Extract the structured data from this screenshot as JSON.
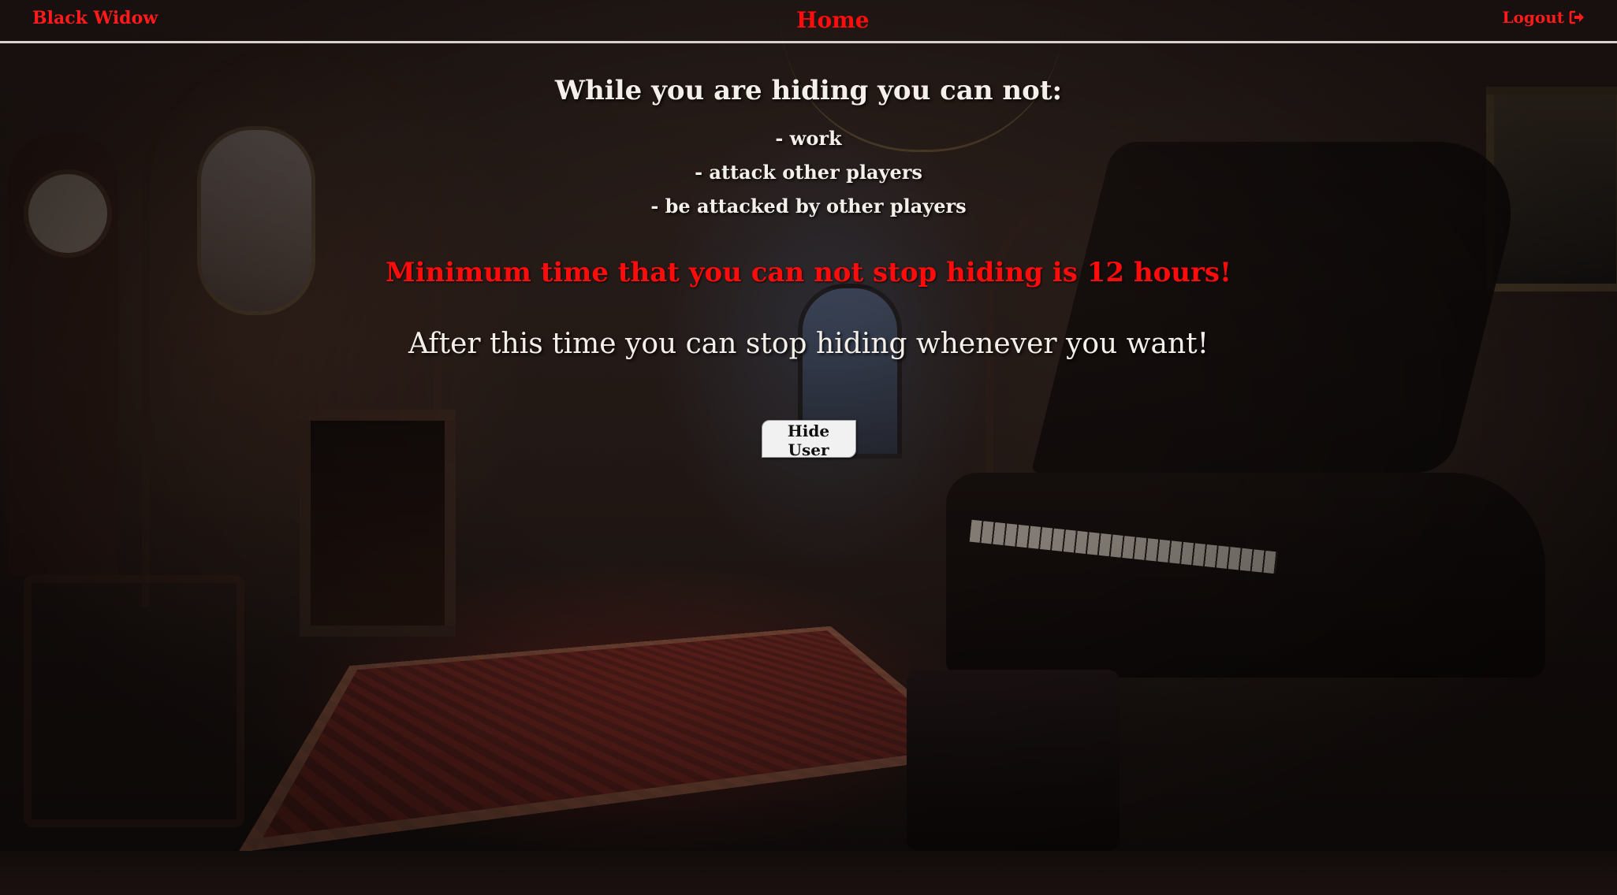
{
  "topbar": {
    "brand": "Black Widow",
    "home": "Home",
    "logout": "Logout",
    "logout_icon": "logout-arrow-icon",
    "accent_color": "#ff1b1b"
  },
  "main": {
    "heading": "While you are hiding you can not:",
    "rules": [
      "- work",
      "- attack other players",
      "- be attacked by other players"
    ],
    "warning": "Minimum time that you can not stop hiding is 12 hours!",
    "after": "After this time you can stop hiding whenever you want!",
    "button_label": "Hide User"
  },
  "colors": {
    "warning": "#ff0b0b",
    "text": "#f4efe8",
    "button_bg": "#f1f1f1"
  }
}
